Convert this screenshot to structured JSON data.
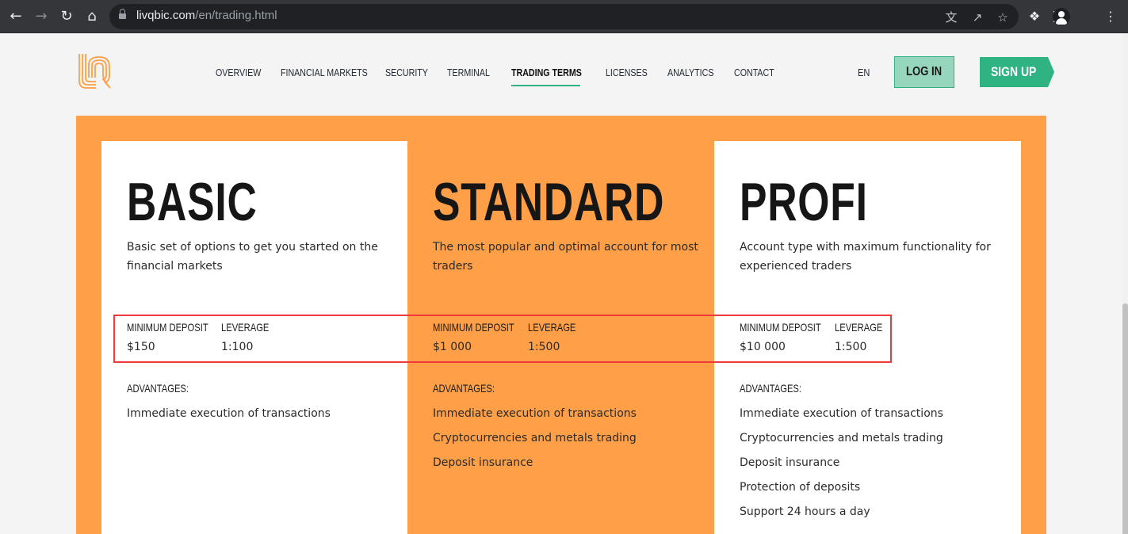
{
  "browser": {
    "url_host": "livqbic.com",
    "url_path": "/en/trading.html",
    "icons": {
      "back": "arrow-left-icon",
      "forward": "arrow-right-icon",
      "reload": "reload-icon",
      "home": "home-icon",
      "lock": "lock-icon",
      "translate": "translate-icon",
      "share": "share-icon",
      "bookmark": "star-icon",
      "extensions": "puzzle-icon",
      "side_panel": "side-panel-icon",
      "profile": "profile-icon",
      "menu": "kebab-menu-icon"
    }
  },
  "header": {
    "nav": [
      {
        "label": "OVERVIEW",
        "active": false
      },
      {
        "label": "FINANCIAL MARKETS",
        "active": false
      },
      {
        "label": "SECURITY",
        "active": false
      },
      {
        "label": "TERMINAL",
        "active": false
      },
      {
        "label": "TRADING TERMS",
        "active": true
      },
      {
        "label": "LICENSES",
        "active": false
      },
      {
        "label": "ANALYTICS",
        "active": false
      },
      {
        "label": "CONTACT",
        "active": false
      }
    ],
    "language": "EN",
    "login_label": "LOG IN",
    "signup_label": "SIGN UP"
  },
  "colors": {
    "brand_orange": "#ff9f47",
    "brand_green": "#2fb383",
    "login_bg": "#95d6bd",
    "highlight_red": "#ee3a3a"
  },
  "plans": [
    {
      "name": "BASIC",
      "description": "Basic set of options to get you started on the financial markets",
      "min_deposit_label": "MINIMUM DEPOSIT",
      "min_deposit": "$150",
      "leverage_label": "LEVERAGE",
      "leverage": "1:100",
      "advantages_label": "ADVANTAGES:",
      "advantages": [
        "Immediate execution of transactions"
      ]
    },
    {
      "name": "STANDARD",
      "description": "The most popular and optimal account for most traders",
      "min_deposit_label": "MINIMUM DEPOSIT",
      "min_deposit": "$1 000",
      "leverage_label": "LEVERAGE",
      "leverage": "1:500",
      "advantages_label": "ADVANTAGES:",
      "advantages": [
        "Immediate execution of transactions",
        "Cryptocurrencies and metals trading",
        "Deposit insurance"
      ]
    },
    {
      "name": "PROFI",
      "description": "Account type with maximum functionality for experienced traders",
      "min_deposit_label": "MINIMUM DEPOSIT",
      "min_deposit": "$10 000",
      "leverage_label": "LEVERAGE",
      "leverage": "1:500",
      "advantages_label": "ADVANTAGES:",
      "advantages": [
        "Immediate execution of transactions",
        "Cryptocurrencies and metals trading",
        "Deposit insurance",
        "Protection of deposits",
        "Support 24 hours a day"
      ]
    }
  ]
}
